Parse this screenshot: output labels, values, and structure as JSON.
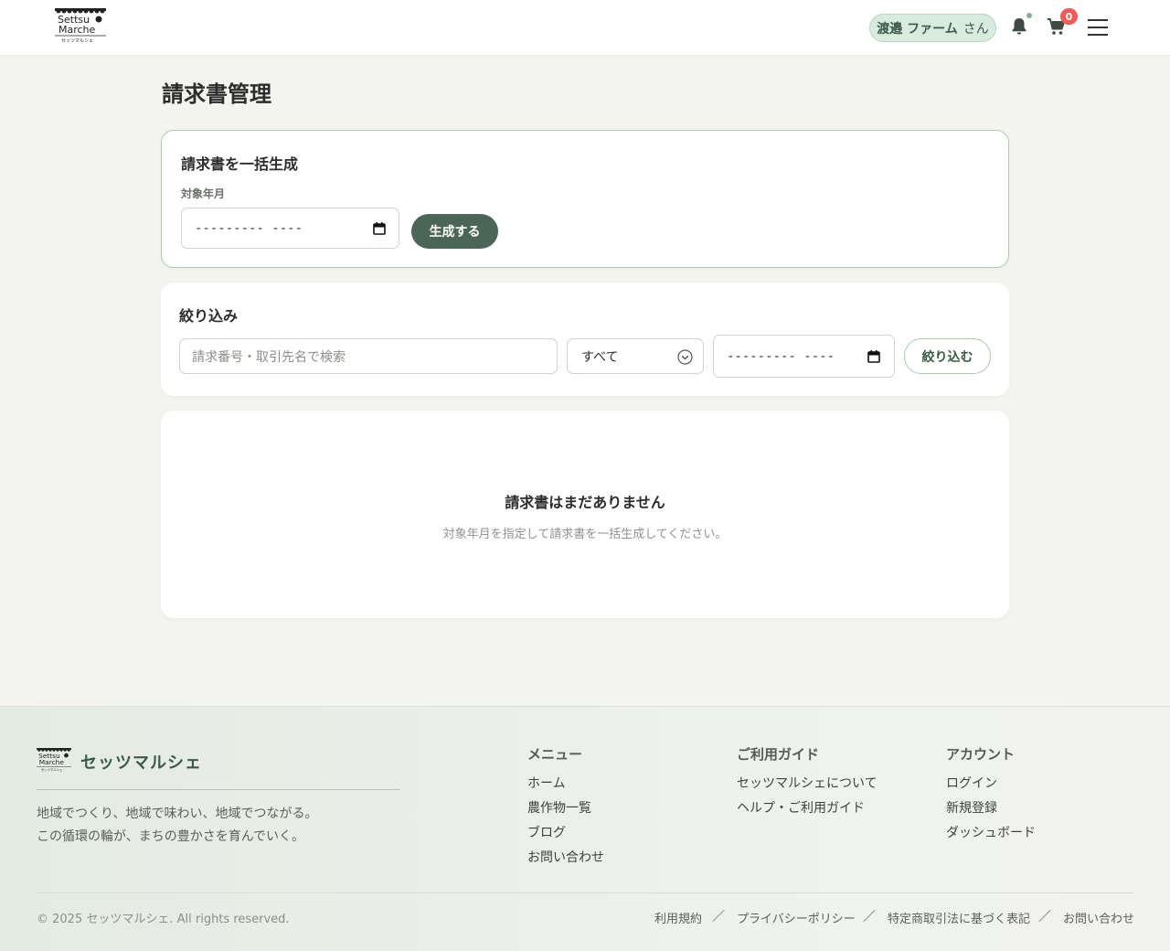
{
  "header": {
    "logo_text_line1": "Settsu",
    "logo_text_line2": "Marche",
    "logo_text_line3": "セッツマルシェ",
    "user_name": "渡邉 ファーム",
    "user_suffix": "さん",
    "cart_count": "0"
  },
  "page": {
    "title": "請求書管理"
  },
  "generate": {
    "title": "請求書を一括生成",
    "month_label": "対象年月",
    "month_value": "---------  ----",
    "button": "生成する"
  },
  "filter": {
    "title": "絞り込み",
    "search_placeholder": "請求番号・取引先名で検索",
    "status_value": "すべて",
    "month_value": "---------  ----",
    "button": "絞り込む"
  },
  "empty": {
    "title": "請求書はまだありません",
    "description": "対象年月を指定して請求書を一括生成してください。"
  },
  "footer": {
    "brand": "セッツマルシェ",
    "tagline_1": "地域でつくり、地域で味わい、地域でつながる。",
    "tagline_2": "この循環の輪が、まちの豊かさを育んでいく。",
    "menu": {
      "title": "メニュー",
      "items": [
        "ホーム",
        "農作物一覧",
        "ブログ",
        "お問い合わせ"
      ]
    },
    "guide": {
      "title": "ご利用ガイド",
      "items": [
        "セッツマルシェについて",
        "ヘルプ・ご利用ガイド"
      ]
    },
    "account": {
      "title": "アカウント",
      "items": [
        "ログイン",
        "新規登録",
        "ダッシュボード"
      ]
    },
    "copyright": "© 2025 セッツマルシェ. All rights reserved.",
    "legal": [
      "利用規約",
      "プライバシーポリシー",
      "特定商取引法に基づく表記",
      "お問い合わせ"
    ],
    "separator": "／"
  },
  "colors": {
    "accent": "#4b6656",
    "badge": "#f05b5b",
    "pill_bg": "#d9ebdc"
  }
}
